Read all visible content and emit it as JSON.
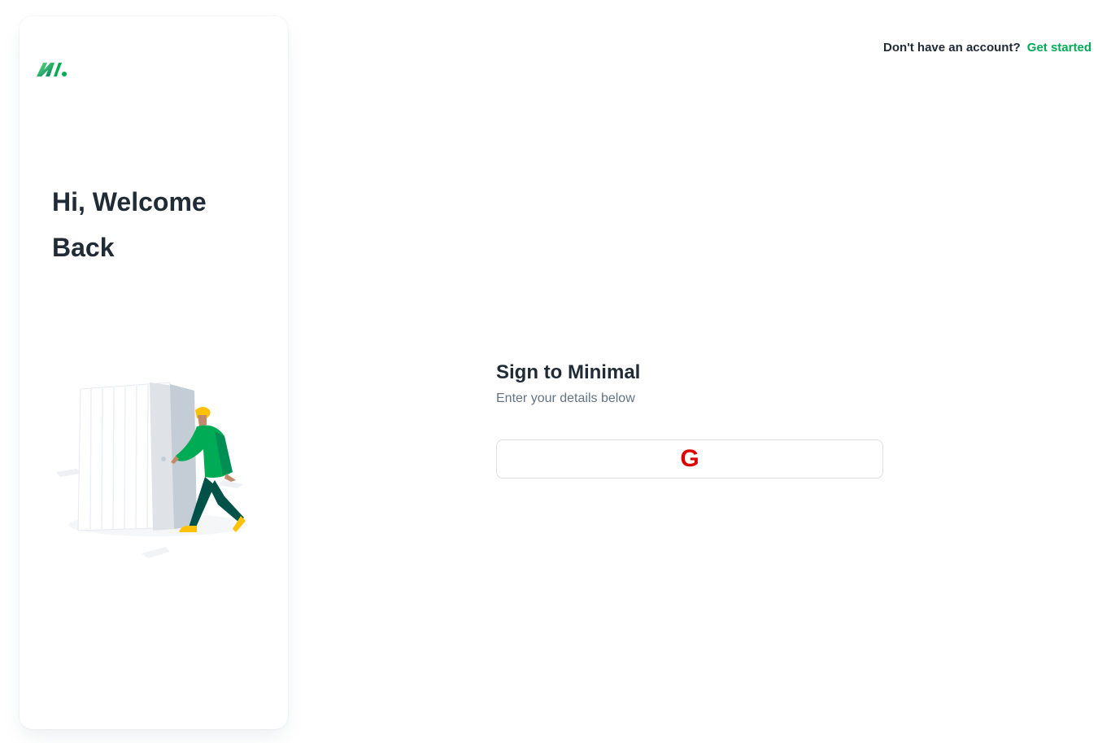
{
  "brand": {
    "logo": "minimal-logo-icon",
    "accent": "#00ab55"
  },
  "header": {
    "prompt": "Don't have an account?",
    "signup_link": "Get started"
  },
  "side": {
    "welcome": "Hi, Welcome Back",
    "illustration": "person-walking-through-door-illustration"
  },
  "form": {
    "title": "Sign to Minimal",
    "subtitle": "Enter your details below",
    "google_label": "G",
    "google_icon": "google-icon"
  },
  "colors": {
    "text_primary": "#212b36",
    "text_secondary": "#637381",
    "google_red": "#df0000"
  }
}
